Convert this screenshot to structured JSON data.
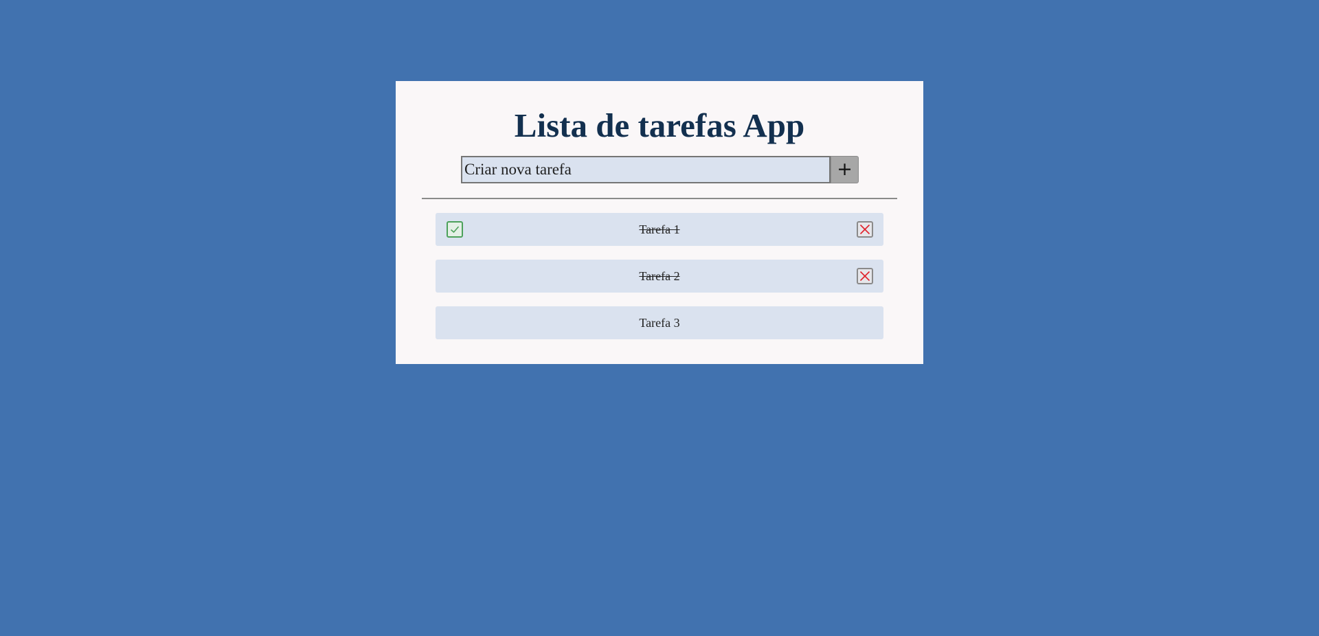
{
  "app": {
    "title": "Lista de tarefas App"
  },
  "new_task": {
    "placeholder": "Criar nova tarefa",
    "add_label": "+"
  },
  "tasks": [
    {
      "label": "Tarefa 1",
      "completed": true,
      "check_icon": "check-icon",
      "delete_icon": "close-icon"
    },
    {
      "label": "Tarefa 2",
      "completed": true,
      "check_icon": null,
      "delete_icon": "close-icon"
    },
    {
      "label": "Tarefa 3",
      "completed": false,
      "check_icon": null,
      "delete_icon": null
    }
  ],
  "colors": {
    "background": "#4172af",
    "card": "#faf7f8",
    "title": "#13304f",
    "item_background": "#dae2ef",
    "check_green": "#4ca15a",
    "delete_red": "#e0202a"
  }
}
